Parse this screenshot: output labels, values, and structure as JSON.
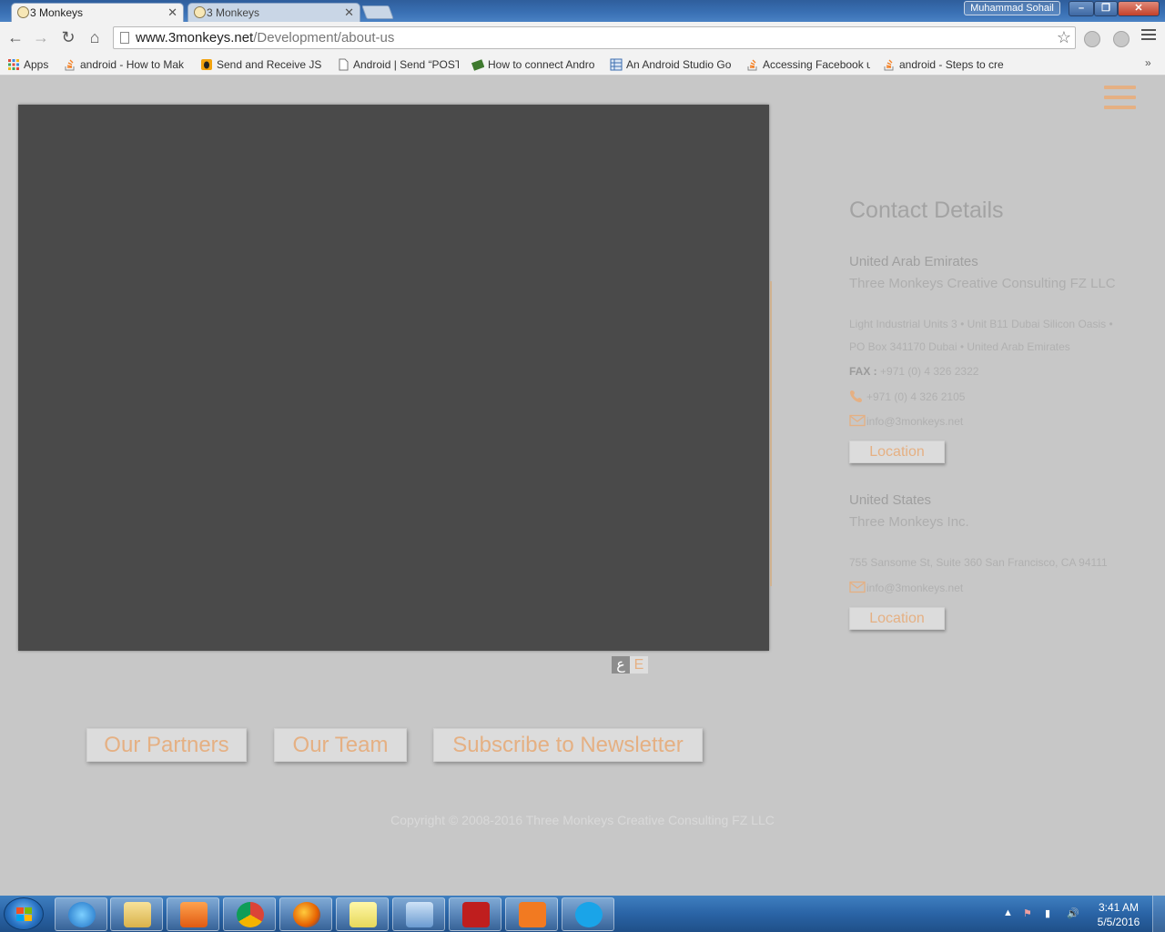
{
  "browser": {
    "tabs": [
      {
        "title": "3 Monkeys",
        "active": true
      },
      {
        "title": "3 Monkeys",
        "active": false
      }
    ],
    "user": "Muhammad Sohail",
    "url_host": "www.3monkeys.net",
    "url_path": "/Development/about-us",
    "bookmarks": [
      {
        "label": "Apps",
        "icon": "apps-grid-icon"
      },
      {
        "label": "android - How to Mak",
        "icon": "stackoverflow-icon"
      },
      {
        "label": "Send and Receive JSO",
        "icon": "bee-icon"
      },
      {
        "label": "Android | Send “POST",
        "icon": "page-icon"
      },
      {
        "label": "How to connect Andro",
        "icon": "android-icon"
      },
      {
        "label": "An Android Studio Go",
        "icon": "grid-page-icon"
      },
      {
        "label": "Accessing Facebook u",
        "icon": "stackoverflow-icon"
      },
      {
        "label": "android - Steps to cre",
        "icon": "stackoverflow-icon"
      }
    ],
    "bookmarks_more": "»"
  },
  "site": {
    "contact_heading": "Contact Details",
    "uae": {
      "region": "United Arab Emirates",
      "company": "Three Monkeys Creative Consulting FZ LLC",
      "address_line1": "Light Industrial Units 3 • Unit B11 Dubai Silicon Oasis •",
      "address_line2": "PO Box 341170 Dubai • United Arab Emirates",
      "fax_label": "FAX :",
      "fax": "+971 (0) 4 326 2322",
      "phone": "+971 (0) 4 326 2105",
      "email": "info@3monkeys.net",
      "location_button": "Location"
    },
    "us": {
      "region": "United States",
      "company": "Three Monkeys Inc.",
      "address": "755 Sansome St, Suite 360 San Francisco, CA 94111",
      "email": "info@3monkeys.net",
      "location_button": "Location"
    },
    "language": {
      "arabic": "ع",
      "english": "E"
    },
    "footer_buttons": {
      "partners": "Our Partners",
      "team": "Our Team",
      "newsletter": "Subscribe to Newsletter"
    },
    "copyright": "Copyright © 2008-2016 Three Monkeys Creative Consulting FZ LLC"
  },
  "taskbar": {
    "apps": [
      "internet-explorer-icon",
      "file-explorer-icon",
      "media-player-icon",
      "chrome-icon",
      "firefox-icon",
      "sticky-notes-icon",
      "virtualbox-icon",
      "filezilla-icon",
      "xampp-icon",
      "skype-icon"
    ],
    "time": "3:41 AM",
    "date": "5/5/2016"
  },
  "colors": {
    "accent": "#e5b083",
    "page_bg": "#c7c7c7",
    "overlay": "#4a4a4a"
  }
}
